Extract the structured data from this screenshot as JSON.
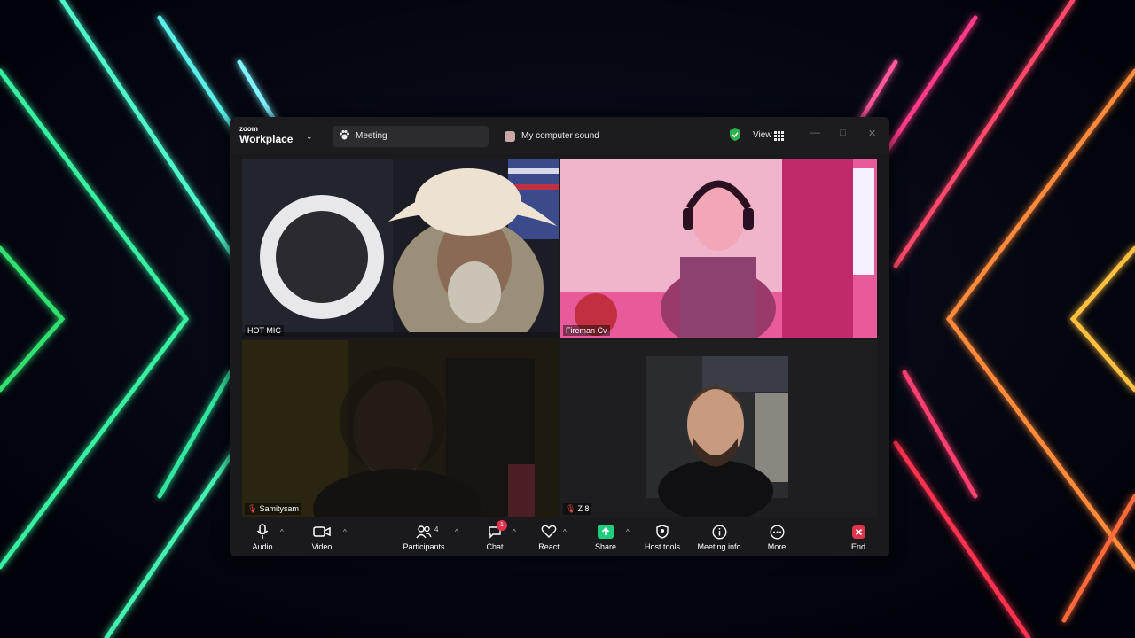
{
  "app": {
    "brand_small": "zoom",
    "brand_name": "Workplace"
  },
  "tabs": {
    "meeting": "Meeting",
    "sound": "My computer sound"
  },
  "header": {
    "view_label": "View"
  },
  "participants": [
    {
      "name": "HOT MIC",
      "muted": false,
      "speaking": true
    },
    {
      "name": "Fireman Cv",
      "muted": false,
      "speaking": false
    },
    {
      "name": "Samitysam",
      "muted": true,
      "speaking": false
    },
    {
      "name": "Z 8",
      "muted": true,
      "speaking": false
    }
  ],
  "toolbar": {
    "audio": "Audio",
    "video": "Video",
    "participants": "Participants",
    "participants_count": "4",
    "chat": "Chat",
    "chat_badge": "1",
    "react": "React",
    "share": "Share",
    "host_tools": "Host tools",
    "meeting_info": "Meeting info",
    "more": "More",
    "end": "End"
  },
  "colors": {
    "speaking_outline": "#2fd38a",
    "share_green": "#1fce7c",
    "end_red": "#e0334d",
    "shield_green": "#2bb24c"
  }
}
